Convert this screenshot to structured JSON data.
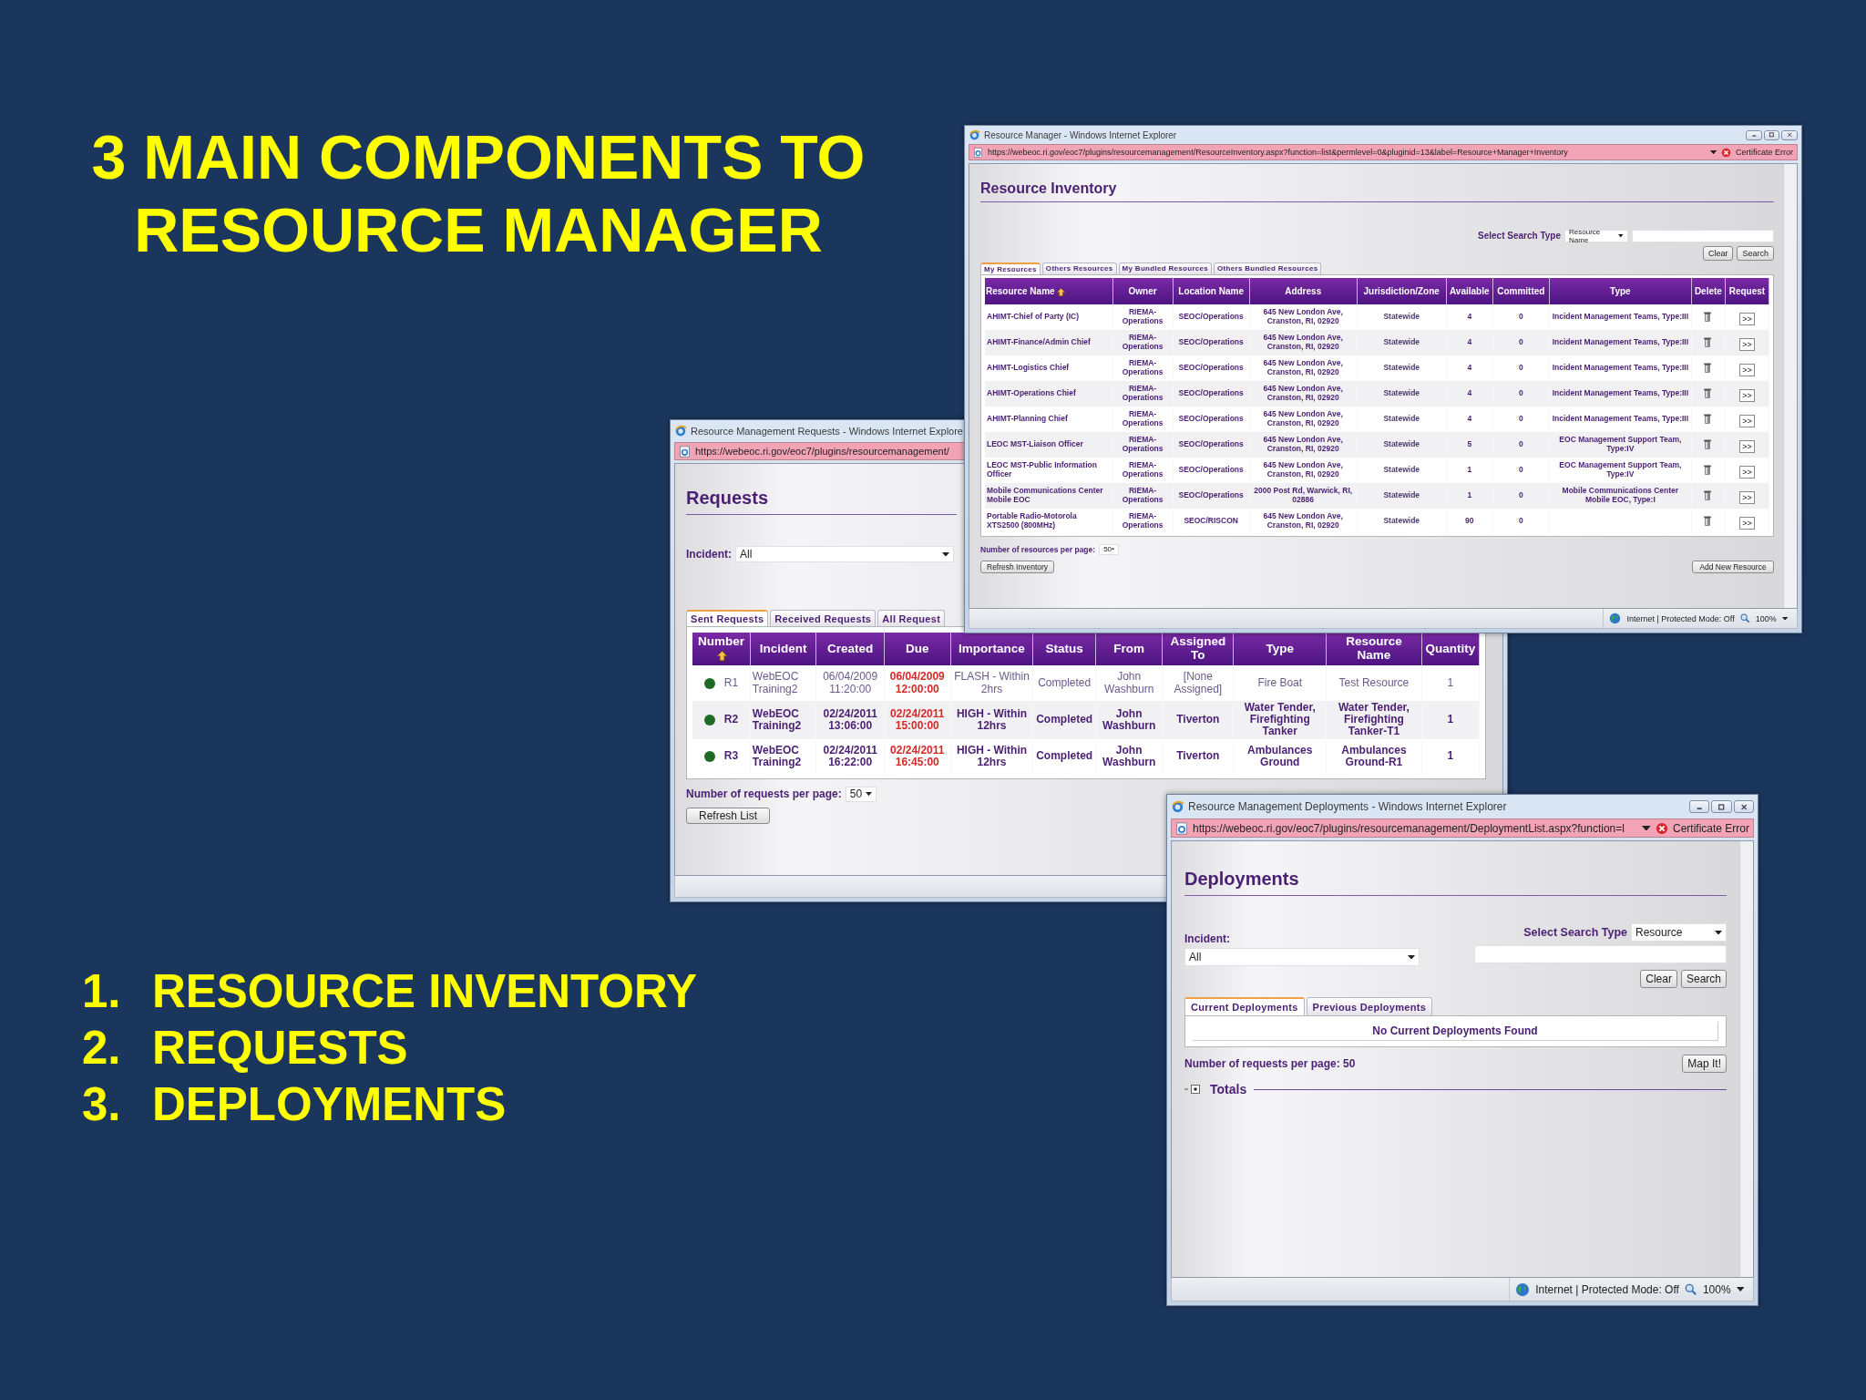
{
  "slide": {
    "title": "3 MAIN COMPONENTS TO RESOURCE MANAGER",
    "list": [
      {
        "number": "1.",
        "text": "RESOURCE INVENTORY"
      },
      {
        "number": "2.",
        "text": "REQUESTS"
      },
      {
        "number": "3.",
        "text": "DEPLOYMENTS"
      }
    ]
  },
  "inventory": {
    "title": "Resource Manager - Windows Internet Explorer",
    "url": "https://webeoc.ri.gov/eoc7/plugins/resourcemanagement/ResourceInventory.aspx?function=list&permlevel=0&pluginid=13&label=Resource+Manager+Inventory",
    "certificate": "Certificate Error",
    "heading": "Resource Inventory",
    "search_label": "Select Search Type",
    "search_type": "Resource Name",
    "buttons": [
      "Clear",
      "Search"
    ],
    "tabs": [
      {
        "label": "My Resources",
        "selected": true
      },
      {
        "label": "Others Resources",
        "selected": false
      },
      {
        "label": "My Bundled Resources",
        "selected": false
      },
      {
        "label": "Others Bundled Resources",
        "selected": false
      }
    ],
    "columns": [
      {
        "label": "Resource Name",
        "sorted": true
      },
      {
        "label": "Owner",
        "sorted": false
      },
      {
        "label": "Location Name",
        "sorted": false
      },
      {
        "label": "Address",
        "sorted": false
      },
      {
        "label": "Jurisdiction/Zone",
        "sorted": false
      },
      {
        "label": "Available",
        "sorted": false
      },
      {
        "label": "Committed",
        "sorted": false
      },
      {
        "label": "Type",
        "sorted": false
      },
      {
        "label": "Delete",
        "sorted": false
      },
      {
        "label": "Request",
        "sorted": false
      }
    ],
    "rows": [
      {
        "name": "AHIMT-Chief of Party (IC)",
        "owner": "RIEMA-Operations",
        "location": "SEOC/Operations",
        "address": "645 New London Ave, Cranston, RI, 02920",
        "zone": "Statewide",
        "available": "4",
        "committed": "0",
        "type": "Incident Management Teams, Type:III",
        "request": ">>"
      },
      {
        "name": "AHIMT-Finance/Admin Chief",
        "owner": "RIEMA-Operations",
        "location": "SEOC/Operations",
        "address": "645 New London Ave, Cranston, RI, 02920",
        "zone": "Statewide",
        "available": "4",
        "committed": "0",
        "type": "Incident Management Teams, Type:III",
        "request": ">>"
      },
      {
        "name": "AHIMT-Logistics Chief",
        "owner": "RIEMA-Operations",
        "location": "SEOC/Operations",
        "address": "645 New London Ave, Cranston, RI, 02920",
        "zone": "Statewide",
        "available": "4",
        "committed": "0",
        "type": "Incident Management Teams, Type:III",
        "request": ">>"
      },
      {
        "name": "AHIMT-Operations Chief",
        "owner": "RIEMA-Operations",
        "location": "SEOC/Operations",
        "address": "645 New London Ave, Cranston, RI, 02920",
        "zone": "Statewide",
        "available": "4",
        "committed": "0",
        "type": "Incident Management Teams, Type:III",
        "request": ">>"
      },
      {
        "name": "AHIMT-Planning Chief",
        "owner": "RIEMA-Operations",
        "location": "SEOC/Operations",
        "address": "645 New London Ave, Cranston, RI, 02920",
        "zone": "Statewide",
        "available": "4",
        "committed": "0",
        "type": "Incident Management Teams, Type:III",
        "request": ">>"
      },
      {
        "name": "LEOC MST-Liaison Officer",
        "owner": "RIEMA-Operations",
        "location": "SEOC/Operations",
        "address": "645 New London Ave, Cranston, RI, 02920",
        "zone": "Statewide",
        "available": "5",
        "committed": "0",
        "type": "EOC Management Support Team, Type:IV",
        "request": ">>"
      },
      {
        "name": "LEOC MST-Public Information Officer",
        "owner": "RIEMA-Operations",
        "location": "SEOC/Operations",
        "address": "645 New London Ave, Cranston, RI, 02920",
        "zone": "Statewide",
        "available": "1",
        "committed": "0",
        "type": "EOC Management Support Team, Type:IV",
        "request": ">>"
      },
      {
        "name": "Mobile Communications Center Mobile EOC",
        "owner": "RIEMA-Operations",
        "location": "SEOC/Operations",
        "address": "2000 Post Rd, Warwick, RI, 02886",
        "zone": "Statewide",
        "available": "1",
        "committed": "0",
        "type": "Mobile Communications Center Mobile EOC, Type:I",
        "request": ">>"
      },
      {
        "name": "Portable Radio-Motorola XTS2500 (800MHz)",
        "owner": "RIEMA-Operations",
        "location": "SEOC/RISCON",
        "address": "645 New London Ave, Cranston, RI, 02920",
        "zone": "Statewide",
        "available": "90",
        "committed": "0",
        "request": ">>"
      }
    ],
    "per_page_label": "Number of resources per page:",
    "per_page": "50",
    "refresh_button": "Refresh Inventory",
    "add_button": "Add New Resource",
    "status": "Internet | Protected Mode: Off",
    "zoom": "100%"
  },
  "requests": {
    "title": "Resource Management Requests - Windows Internet Explore",
    "url": "https://webeoc.ri.gov/eoc7/plugins/resourcemanagement/",
    "heading": "Requests",
    "incident_label": "Incident:",
    "incident": "All",
    "tabs": [
      {
        "label": "Sent Requests",
        "selected": true
      },
      {
        "label": "Received Requests",
        "selected": false
      },
      {
        "label": "All Request",
        "selected": false
      }
    ],
    "columns": [
      {
        "label": "Number",
        "sorted": true
      },
      {
        "label": "Incident",
        "sorted": false
      },
      {
        "label": "Created",
        "sorted": false
      },
      {
        "label": "Due",
        "sorted": false
      },
      {
        "label": "Importance",
        "sorted": false
      },
      {
        "label": "Status",
        "sorted": false
      },
      {
        "label": "From",
        "sorted": false
      },
      {
        "label": "Assigned To",
        "sorted": false
      },
      {
        "label": "Type",
        "sorted": false
      },
      {
        "label": "Resource Name",
        "sorted": false
      },
      {
        "label": "Quantity",
        "sorted": false
      }
    ],
    "rows": [
      {
        "color": "#1f6b23",
        "number": "R1",
        "emphasized": false,
        "incident": "WebEOC Training2",
        "created": "06/04/2009 11:20:00",
        "due": "06/04/2009 12:00:00",
        "importance": "FLASH - Within 2hrs",
        "status": "Completed",
        "from": "John Washburn",
        "assigned_to": "[None Assigned]",
        "type": "Fire Boat",
        "resource_name": "Test Resource",
        "quantity": "1"
      },
      {
        "color": "#1f6b23",
        "number": "R2",
        "emphasized": true,
        "incident": "WebEOC Training2",
        "created": "02/24/2011 13:06:00",
        "due": "02/24/2011 15:00:00",
        "importance": "HIGH - Within 12hrs",
        "status": "Completed",
        "from": "John Washburn",
        "assigned_to": "Tiverton",
        "type": "Water Tender, Firefighting Tanker",
        "resource_name": "Water Tender, Firefighting Tanker-T1",
        "quantity": "1"
      },
      {
        "color": "#1f6b23",
        "number": "R3",
        "emphasized": true,
        "incident": "WebEOC Training2",
        "created": "02/24/2011 16:22:00",
        "due": "02/24/2011 16:45:00",
        "importance": "HIGH - Within 12hrs",
        "status": "Completed",
        "from": "John Washburn",
        "assigned_to": "Tiverton",
        "type": "Ambulances Ground",
        "resource_name": "Ambulances Ground-R1",
        "quantity": "1"
      }
    ],
    "per_page_label": "Number of requests per page:",
    "per_page": "50",
    "refresh_button": "Refresh List"
  },
  "deployments": {
    "title": "Resource Management Deployments - Windows Internet Explorer",
    "url": "https://webeoc.ri.gov/eoc7/plugins/resourcemanagement/DeploymentList.aspx?function=l",
    "certificate": "Certificate Error",
    "heading": "Deployments",
    "incident_label": "Incident:",
    "incident": "All",
    "search_label": "Select Search Type",
    "search_type": "Resource",
    "buttons": [
      "Clear",
      "Search"
    ],
    "tabs": [
      {
        "label": "Current Deployments",
        "selected": true
      },
      {
        "label": "Previous Deployments",
        "selected": false
      }
    ],
    "empty_message": "No Current Deployments Found",
    "per_page_text": "Number of requests per page: 50",
    "map_button": "Map It!",
    "totals": {
      "label": "Totals",
      "expanded": false
    },
    "status": "Internet | Protected Mode: Off",
    "zoom": "100%"
  }
}
